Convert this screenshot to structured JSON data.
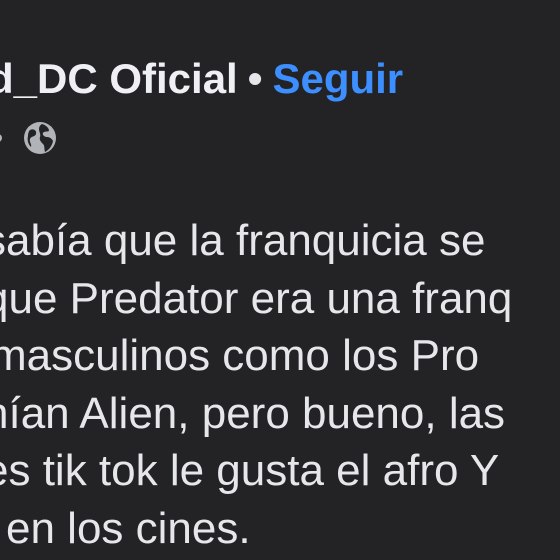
{
  "post": {
    "author": "d_DC Oficial",
    "separator": "•",
    "follow_label": "Seguir",
    "audience_icon": "globe-icon",
    "lines": [
      "sabía que la franquicia se",
      "que Predator era una franq",
      "masculinos como los Pro",
      "nían Alien, pero bueno, las",
      "es tik tok le gusta el afro Y",
      "en los cines."
    ]
  },
  "colors": {
    "background": "#232325",
    "text": "#e6e7eb",
    "link": "#3d8eff",
    "secondary": "#b0b3b8"
  }
}
